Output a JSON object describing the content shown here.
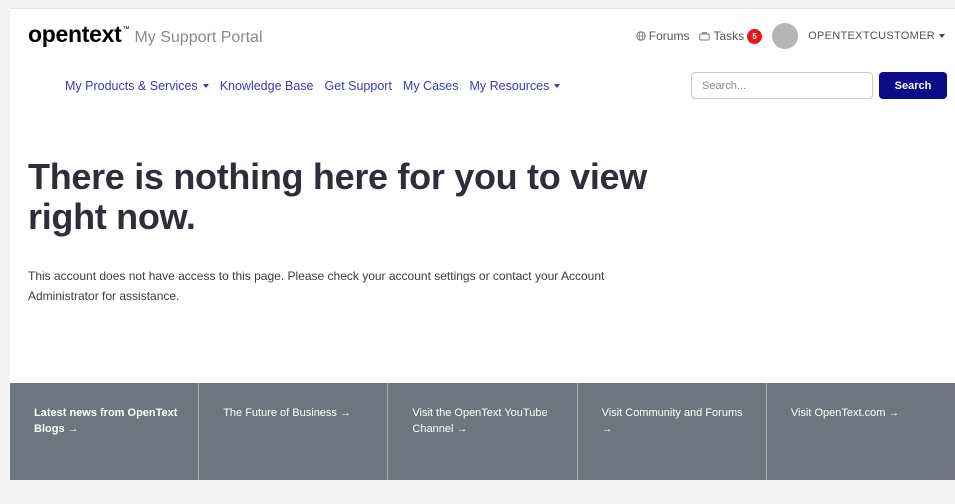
{
  "header": {
    "logo_text": "opentext",
    "logo_tm": "™",
    "portal_title": "My Support Portal",
    "forums_label": "Forums",
    "tasks_label": "Tasks",
    "tasks_count": "5",
    "username": "OPENTEXTCUSTOMER"
  },
  "nav": {
    "items": [
      {
        "label": "My Products & Services",
        "dropdown": true
      },
      {
        "label": "Knowledge Base",
        "dropdown": false
      },
      {
        "label": "Get Support",
        "dropdown": false
      },
      {
        "label": "My Cases",
        "dropdown": false
      },
      {
        "label": "My Resources",
        "dropdown": true
      }
    ]
  },
  "search": {
    "placeholder": "Search...",
    "button_label": "Search"
  },
  "main": {
    "headline": "There is nothing here for you to view right now.",
    "message": "This account does not have access to this page. Please check your account settings or contact your Account Administrator for assistance."
  },
  "promo": {
    "items": [
      {
        "label": "Latest news from OpenText Blogs →"
      },
      {
        "label": "The Future of Business →"
      },
      {
        "label": "Visit the OpenText YouTube Channel →"
      },
      {
        "label": "Visit Community and Forums →"
      },
      {
        "label": "Visit OpenText.com →"
      }
    ]
  },
  "colors": {
    "nav_link": "#3a3ab4",
    "search_button": "#0b0b8a",
    "badge": "#e8161b",
    "promo_band": "#6e7581",
    "headline": "#2e2e38"
  },
  "icons": {
    "forums": "globe-icon",
    "tasks": "briefcase-icon",
    "dropdown": "caret-down-icon"
  }
}
